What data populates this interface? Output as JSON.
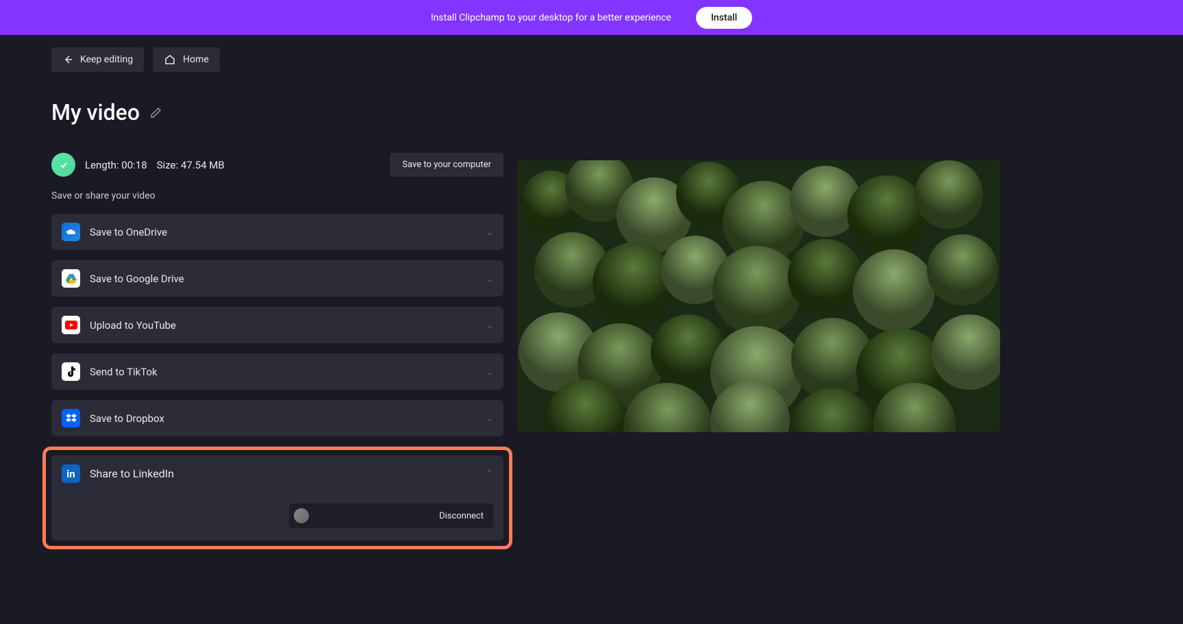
{
  "banner": {
    "text": "Install Clipchamp to your desktop for a better experience",
    "button": "Install"
  },
  "nav": {
    "keep_editing": "Keep editing",
    "home": "Home"
  },
  "title": "My video",
  "status": {
    "length_label": "Length:",
    "length_value": "00:18",
    "size_label": "Size:",
    "size_value": "47.54 MB"
  },
  "save_computer_button": "Save to your computer",
  "share_section_label": "Save or share your video",
  "share_options": {
    "onedrive": "Save to OneDrive",
    "gdrive": "Save to Google Drive",
    "youtube": "Upload to YouTube",
    "tiktok": "Send to TikTok",
    "dropbox": "Save to Dropbox",
    "linkedin": "Share to LinkedIn"
  },
  "linkedin_panel": {
    "disconnect": "Disconnect"
  }
}
